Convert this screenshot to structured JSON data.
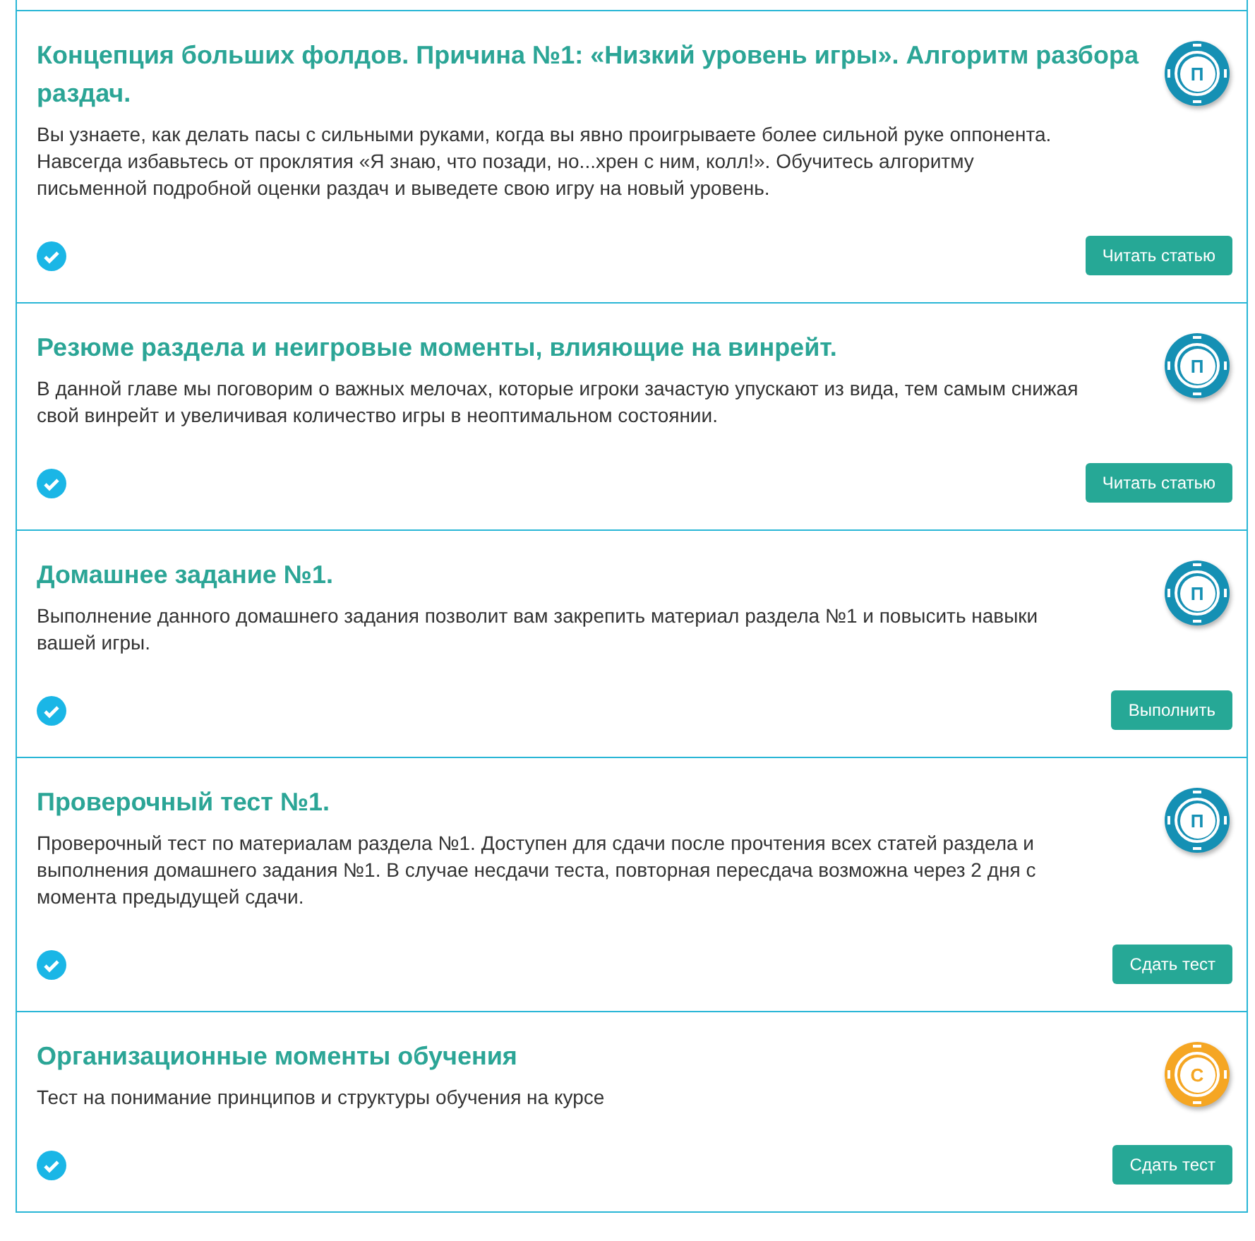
{
  "lessons": [
    {
      "title": "Концепция больших фолдов. Причина №1: «Низкий уровень игры». Алгоритм разбора раздач.",
      "description": "Вы узнаете, как делать пасы с сильными руками, когда вы явно проигрываете более сильной руке оппонента. Навсегда избавьтесь от проклятия «Я знаю, что позади, но...хрен с ним, колл!». Обучитесь алгоритму письменной подробной оценки раздач и выведете свою игру на новый уровень.",
      "chip": {
        "letter": "П",
        "color": "#1590b4"
      },
      "done": true,
      "button": "Читать статью"
    },
    {
      "title": "Резюме раздела и неигровые моменты, влияющие на винрейт.",
      "description": "В данной главе мы поговорим о важных мелочах, которые игроки зачастую упускают из вида, тем самым снижая свой винрейт и увеличивая количество игры в неоптимальном состоянии.",
      "chip": {
        "letter": "П",
        "color": "#1590b4"
      },
      "done": true,
      "button": "Читать статью"
    },
    {
      "title": "Домашнее задание №1.",
      "description": "Выполнение данного домашнего задания позволит вам закрепить материал раздела №1 и повысить навыки вашей игры.",
      "chip": {
        "letter": "П",
        "color": "#1590b4"
      },
      "done": true,
      "button": "Выполнить"
    },
    {
      "title": "Проверочный тест №1.",
      "description": "Проверочный тест по материалам раздела №1. Доступен для сдачи после прочтения всех статей раздела и выполнения домашнего задания №1. В случае несдачи теста, повторная пересдача возможна через 2 дня с момента предыдущей сдачи.",
      "chip": {
        "letter": "П",
        "color": "#1590b4"
      },
      "done": true,
      "button": "Сдать тест"
    },
    {
      "title": "Организационные моменты обучения",
      "description": "Тест на понимание принципов и структуры обучения на курсе",
      "chip": {
        "letter": "С",
        "color": "#f5a623"
      },
      "done": true,
      "button": "Сдать тест"
    }
  ]
}
